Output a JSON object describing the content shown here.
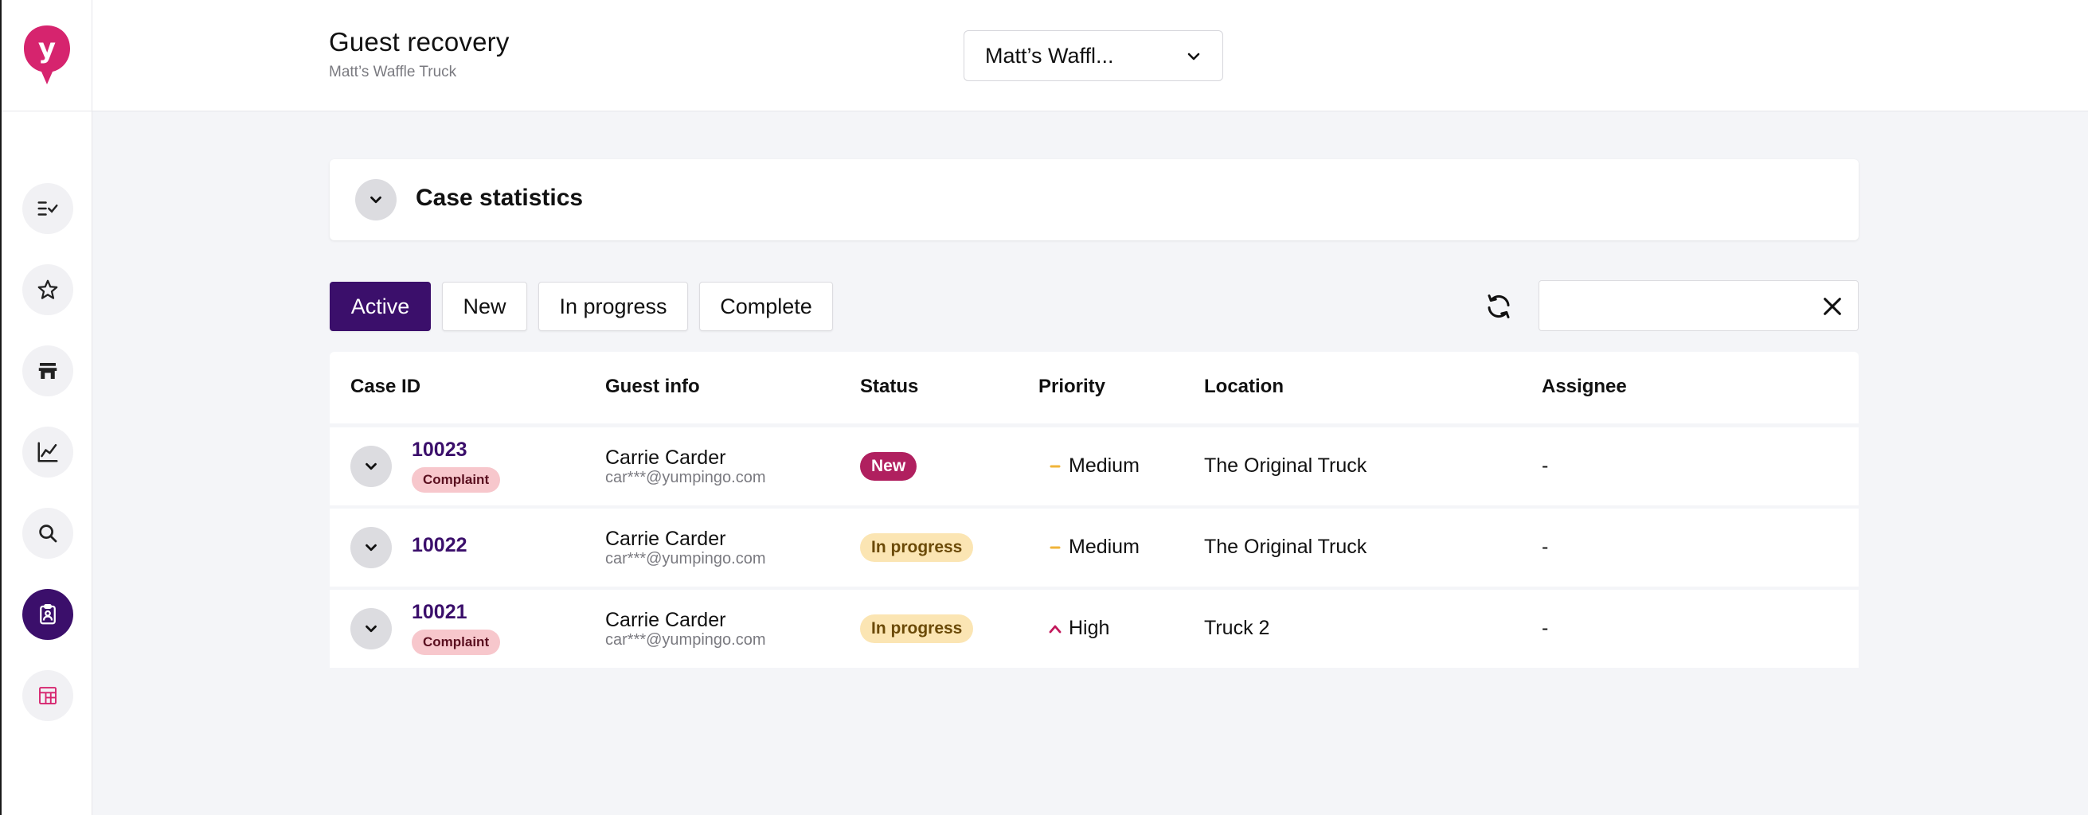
{
  "header": {
    "title": "Guest recovery",
    "subtitle": "Matt’s Waffle Truck",
    "location_select": "Matt’s Waffl..."
  },
  "sidebar": {
    "logo": "y",
    "items": [
      {
        "icon": "checklist-icon",
        "active": false
      },
      {
        "icon": "star-icon",
        "active": false
      },
      {
        "icon": "store-icon",
        "active": false
      },
      {
        "icon": "chart-icon",
        "active": false
      },
      {
        "icon": "search-icon",
        "active": false
      },
      {
        "icon": "clipboard-user-icon",
        "active": true
      },
      {
        "icon": "calendar-table-icon",
        "active": false
      }
    ]
  },
  "stats": {
    "title": "Case statistics"
  },
  "tabs": {
    "active": "Active",
    "new": "New",
    "in_progress": "In progress",
    "complete": "Complete"
  },
  "search": {
    "value": "",
    "placeholder": ""
  },
  "table": {
    "headers": {
      "case_id": "Case ID",
      "guest_info": "Guest info",
      "status": "Status",
      "priority": "Priority",
      "location": "Location",
      "assignee": "Assignee"
    },
    "rows": [
      {
        "case_id": "10023",
        "tag": "Complaint",
        "guest_name": "Carrie Carder",
        "guest_email": "car***@yumpingo.com",
        "status": "New",
        "priority": "Medium",
        "location": "The Original Truck",
        "assignee": "-"
      },
      {
        "case_id": "10022",
        "tag": "",
        "guest_name": "Carrie Carder",
        "guest_email": "car***@yumpingo.com",
        "status": "In progress",
        "priority": "Medium",
        "location": "The Original Truck",
        "assignee": "-"
      },
      {
        "case_id": "10021",
        "tag": "Complaint",
        "guest_name": "Carrie Carder",
        "guest_email": "car***@yumpingo.com",
        "status": "In progress",
        "priority": "High",
        "location": "Truck 2",
        "assignee": "-"
      }
    ]
  },
  "colors": {
    "brand": "#d6246e",
    "accent": "#3b0f6b",
    "status_new": "#b0205f",
    "status_in_progress": "#fbe5b3",
    "priority_medium": "#f0b43a",
    "priority_high": "#c2185b"
  }
}
